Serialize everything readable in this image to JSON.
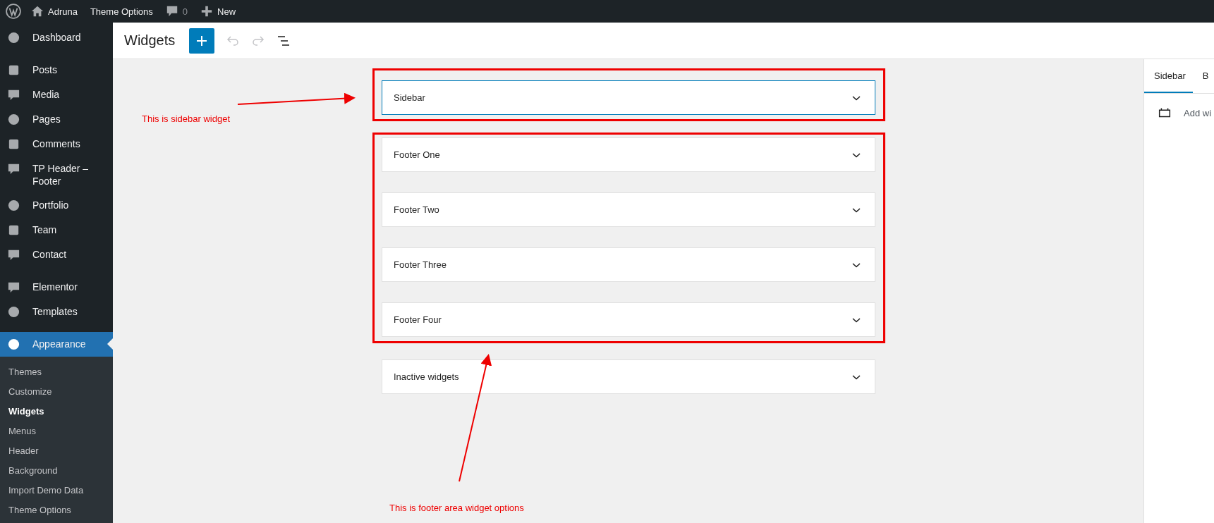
{
  "admin_bar": {
    "site": "Adruna",
    "theme_options": "Theme Options",
    "comments": "0",
    "new": "New"
  },
  "menu_groups": [
    [
      {
        "label": "Dashboard",
        "selected": false
      }
    ],
    [
      {
        "label": "Posts",
        "selected": false
      },
      {
        "label": "Media",
        "selected": false
      },
      {
        "label": "Pages",
        "selected": false
      },
      {
        "label": "Comments",
        "selected": false
      },
      {
        "label": "TP Header – Footer",
        "selected": false
      },
      {
        "label": "Portfolio",
        "selected": false
      },
      {
        "label": "Team",
        "selected": false
      },
      {
        "label": "Contact",
        "selected": false
      }
    ],
    [
      {
        "label": "Elementor",
        "selected": false
      },
      {
        "label": "Templates",
        "selected": false
      }
    ],
    [
      {
        "label": "Appearance",
        "selected": true,
        "submenu": [
          {
            "label": "Themes",
            "selected": false
          },
          {
            "label": "Customize",
            "selected": false
          },
          {
            "label": "Widgets",
            "selected": true
          },
          {
            "label": "Menus",
            "selected": false
          },
          {
            "label": "Header",
            "selected": false
          },
          {
            "label": "Background",
            "selected": false
          },
          {
            "label": "Import Demo Data",
            "selected": false
          },
          {
            "label": "Theme Options",
            "selected": false
          }
        ]
      }
    ]
  ],
  "header": {
    "title": "Widgets"
  },
  "widget_groups": [
    {
      "highlighted": true,
      "areas": [
        {
          "title": "Sidebar",
          "selected": true
        }
      ]
    },
    {
      "highlighted": true,
      "areas": [
        {
          "title": "Footer One",
          "selected": false
        },
        {
          "title": "Footer Two",
          "selected": false
        },
        {
          "title": "Footer Three",
          "selected": false
        },
        {
          "title": "Footer Four",
          "selected": false
        }
      ]
    },
    {
      "highlighted": false,
      "areas": [
        {
          "title": "Inactive widgets",
          "selected": false
        }
      ]
    }
  ],
  "annotations": [
    {
      "text": "This is sidebar widget"
    },
    {
      "text": "This is footer area widget options"
    }
  ],
  "settings_panel": {
    "tabs": [
      {
        "label": "Sidebar",
        "selected": true
      },
      {
        "label": "B",
        "selected": false
      }
    ],
    "add_widget": "Add wi"
  }
}
